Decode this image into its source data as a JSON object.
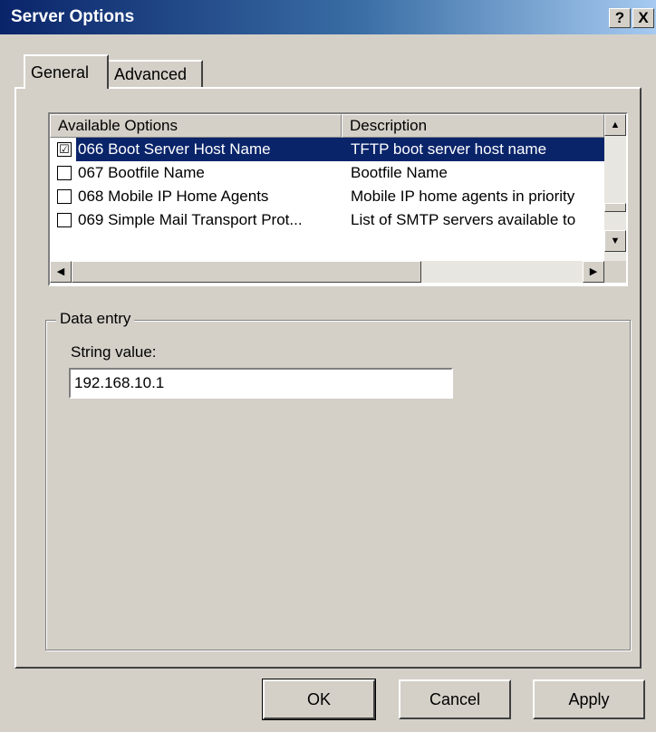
{
  "window": {
    "title": "Server Options",
    "help_button": "?",
    "close_button": "X"
  },
  "tabs": [
    {
      "label": "General",
      "active": true
    },
    {
      "label": "Advanced",
      "active": false
    }
  ],
  "options_list": {
    "columns": [
      "Available Options",
      "Description"
    ],
    "rows": [
      {
        "name": "066 Boot Server Host Name",
        "description": "TFTP boot server host name",
        "checked": "☑",
        "selected": true
      },
      {
        "name": "067 Bootfile Name",
        "description": "Bootfile Name",
        "checked": "",
        "selected": false
      },
      {
        "name": "068 Mobile IP Home Agents",
        "description": "Mobile IP home agents in priority",
        "checked": "",
        "selected": false
      },
      {
        "name": "069 Simple Mail Transport Prot...",
        "description": "List of SMTP servers available to",
        "checked": "",
        "selected": false
      }
    ]
  },
  "data_entry": {
    "group_label": "Data entry",
    "field_label": "String value:",
    "string_value": "192.168.10.1"
  },
  "buttons": {
    "ok": "OK",
    "cancel": "Cancel",
    "apply": "Apply"
  },
  "colors": {
    "selection": "#0a246a",
    "dialog_face": "#d4d0c8"
  }
}
